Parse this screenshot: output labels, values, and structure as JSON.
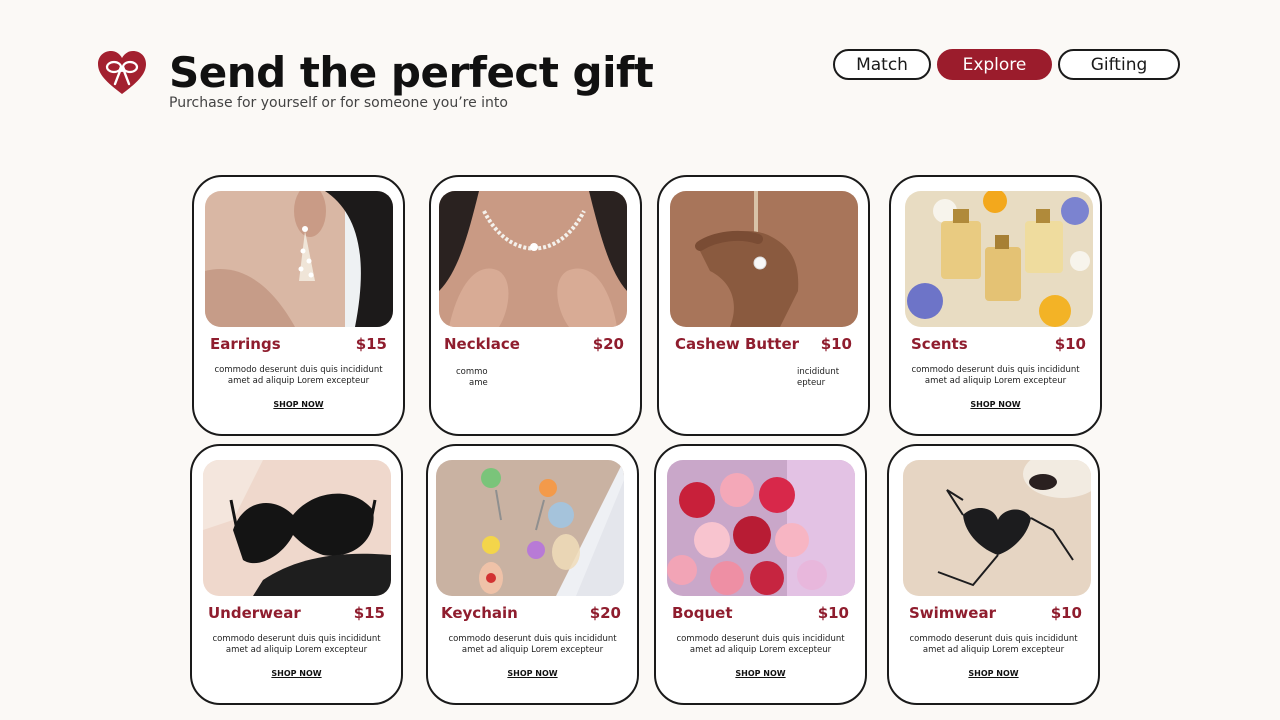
{
  "header": {
    "title": "Send the perfect gift",
    "subtitle": "Purchase for yourself or for someone you’re into",
    "logo_icon": "heart-bow-icon"
  },
  "nav": {
    "tabs": [
      {
        "label": "Match",
        "active": false
      },
      {
        "label": "Explore",
        "active": true
      },
      {
        "label": "Gifting",
        "active": false
      }
    ]
  },
  "colors": {
    "accent": "#9b1c2c",
    "product_name": "#8f1d2e",
    "background": "#fbf9f6"
  },
  "products": [
    {
      "name": "Earrings",
      "price": "$15",
      "desc_line1": "commodo deserunt duis quis incididunt",
      "desc_line2": "amet ad aliquip Lorem excepteur",
      "cta": "SHOP NOW",
      "image": "earring-photo"
    },
    {
      "name": "Necklace",
      "price": "$20",
      "desc_frag1": "commo",
      "desc_frag2": "ame",
      "image": "necklace-photo"
    },
    {
      "name": "Cashew Butter",
      "price": "$10",
      "desc_frag1": "incididunt",
      "desc_frag2": "epteur",
      "image": "ring-hand-photo"
    },
    {
      "name": "Scents",
      "price": "$10",
      "desc_line1": "commodo deserunt duis quis incididunt",
      "desc_line2": "amet ad aliquip Lorem excepteur",
      "cta": "SHOP NOW",
      "image": "perfume-photo"
    },
    {
      "name": "Underwear",
      "price": "$15",
      "desc_line1": "commodo deserunt duis quis incididunt",
      "desc_line2": "amet ad aliquip Lorem excepteur",
      "cta": "SHOP NOW",
      "image": "bra-photo"
    },
    {
      "name": "Keychain",
      "price": "$20",
      "desc_line1": "commodo deserunt duis quis incididunt",
      "desc_line2": "amet ad aliquip Lorem excepteur",
      "cta": "SHOP NOW",
      "image": "keychain-photo"
    },
    {
      "name": "Boquet",
      "price": "$10",
      "desc_line1": "commodo deserunt duis quis incididunt",
      "desc_line2": "amet ad aliquip Lorem excepteur",
      "cta": "SHOP NOW",
      "image": "bouquet-photo"
    },
    {
      "name": "Swimwear",
      "price": "$10",
      "desc_line1": "commodo deserunt duis quis incididunt",
      "desc_line2": "amet ad aliquip Lorem excepteur",
      "cta": "SHOP NOW",
      "image": "swimwear-photo"
    }
  ]
}
